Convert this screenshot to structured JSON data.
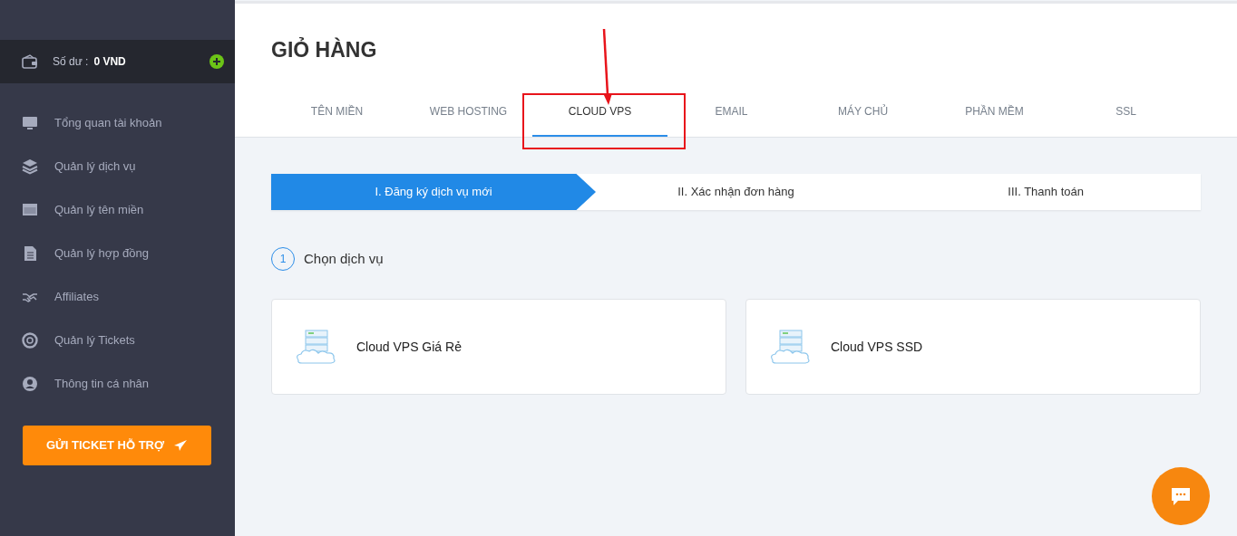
{
  "sidebar": {
    "balance": {
      "label": "Số dư :",
      "value": "0 VND"
    },
    "items": [
      {
        "label": "Tổng quan tài khoản",
        "kind": "monitor"
      },
      {
        "label": "Quản lý dịch vụ",
        "kind": "layers"
      },
      {
        "label": "Quản lý tên miền",
        "kind": "browser"
      },
      {
        "label": "Quản lý hợp đồng",
        "kind": "document"
      },
      {
        "label": "Affiliates",
        "kind": "handshake"
      },
      {
        "label": "Quản lý Tickets",
        "kind": "lifebuoy"
      },
      {
        "label": "Thông tin cá nhân",
        "kind": "user"
      }
    ],
    "support_button": "GỬI TICKET HỖ TRỢ"
  },
  "page_title": "GIỎ HÀNG",
  "tabs": [
    {
      "label": "TÊN MIỀN",
      "selected": false
    },
    {
      "label": "WEB HOSTING",
      "selected": false
    },
    {
      "label": "CLOUD VPS",
      "selected": true
    },
    {
      "label": "EMAIL",
      "selected": false
    },
    {
      "label": "MÁY CHỦ",
      "selected": false
    },
    {
      "label": "PHẦN MỀM",
      "selected": false
    },
    {
      "label": "SSL",
      "selected": false
    }
  ],
  "steps": [
    {
      "label": "I. Đăng ký dịch vụ mới",
      "selected": true
    },
    {
      "label": "II. Xác nhận đơn hàng",
      "selected": false
    },
    {
      "label": "III. Thanh toán",
      "selected": false
    }
  ],
  "section": {
    "number": "1",
    "title": "Chọn dịch vụ"
  },
  "services": [
    {
      "label": "Cloud VPS Giá Rẻ"
    },
    {
      "label": "Cloud VPS SSD"
    }
  ]
}
